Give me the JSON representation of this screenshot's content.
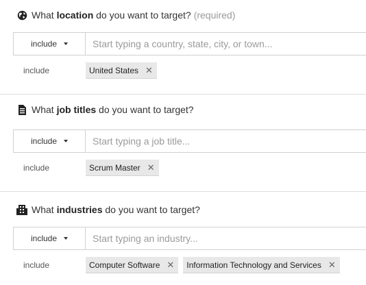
{
  "sections": [
    {
      "heading": {
        "prefix": "What ",
        "bold": "location",
        "suffix": " do you want to target?",
        "required": "(required)"
      },
      "icon": "globe-icon",
      "select_value": "include",
      "placeholder": "Start typing a country, state, city, or town...",
      "tag_label": "include",
      "tags": [
        "United States"
      ]
    },
    {
      "heading": {
        "prefix": "What ",
        "bold": "job titles",
        "suffix": " do you want to target?"
      },
      "icon": "document-icon",
      "select_value": "include",
      "placeholder": "Start typing a job title...",
      "tag_label": "include",
      "tags": [
        "Scrum Master"
      ]
    },
    {
      "heading": {
        "prefix": "What ",
        "bold": "industries",
        "suffix": " do you want to target?"
      },
      "icon": "building-icon",
      "select_value": "include",
      "placeholder": "Start typing an industry...",
      "tag_label": "include",
      "tags": [
        "Computer Software",
        "Information Technology and Services"
      ]
    }
  ],
  "remove_glyph": "✕",
  "colors": {
    "border": "#d0d0d0",
    "tag_bg": "#e8e8e8",
    "muted": "#999999"
  }
}
